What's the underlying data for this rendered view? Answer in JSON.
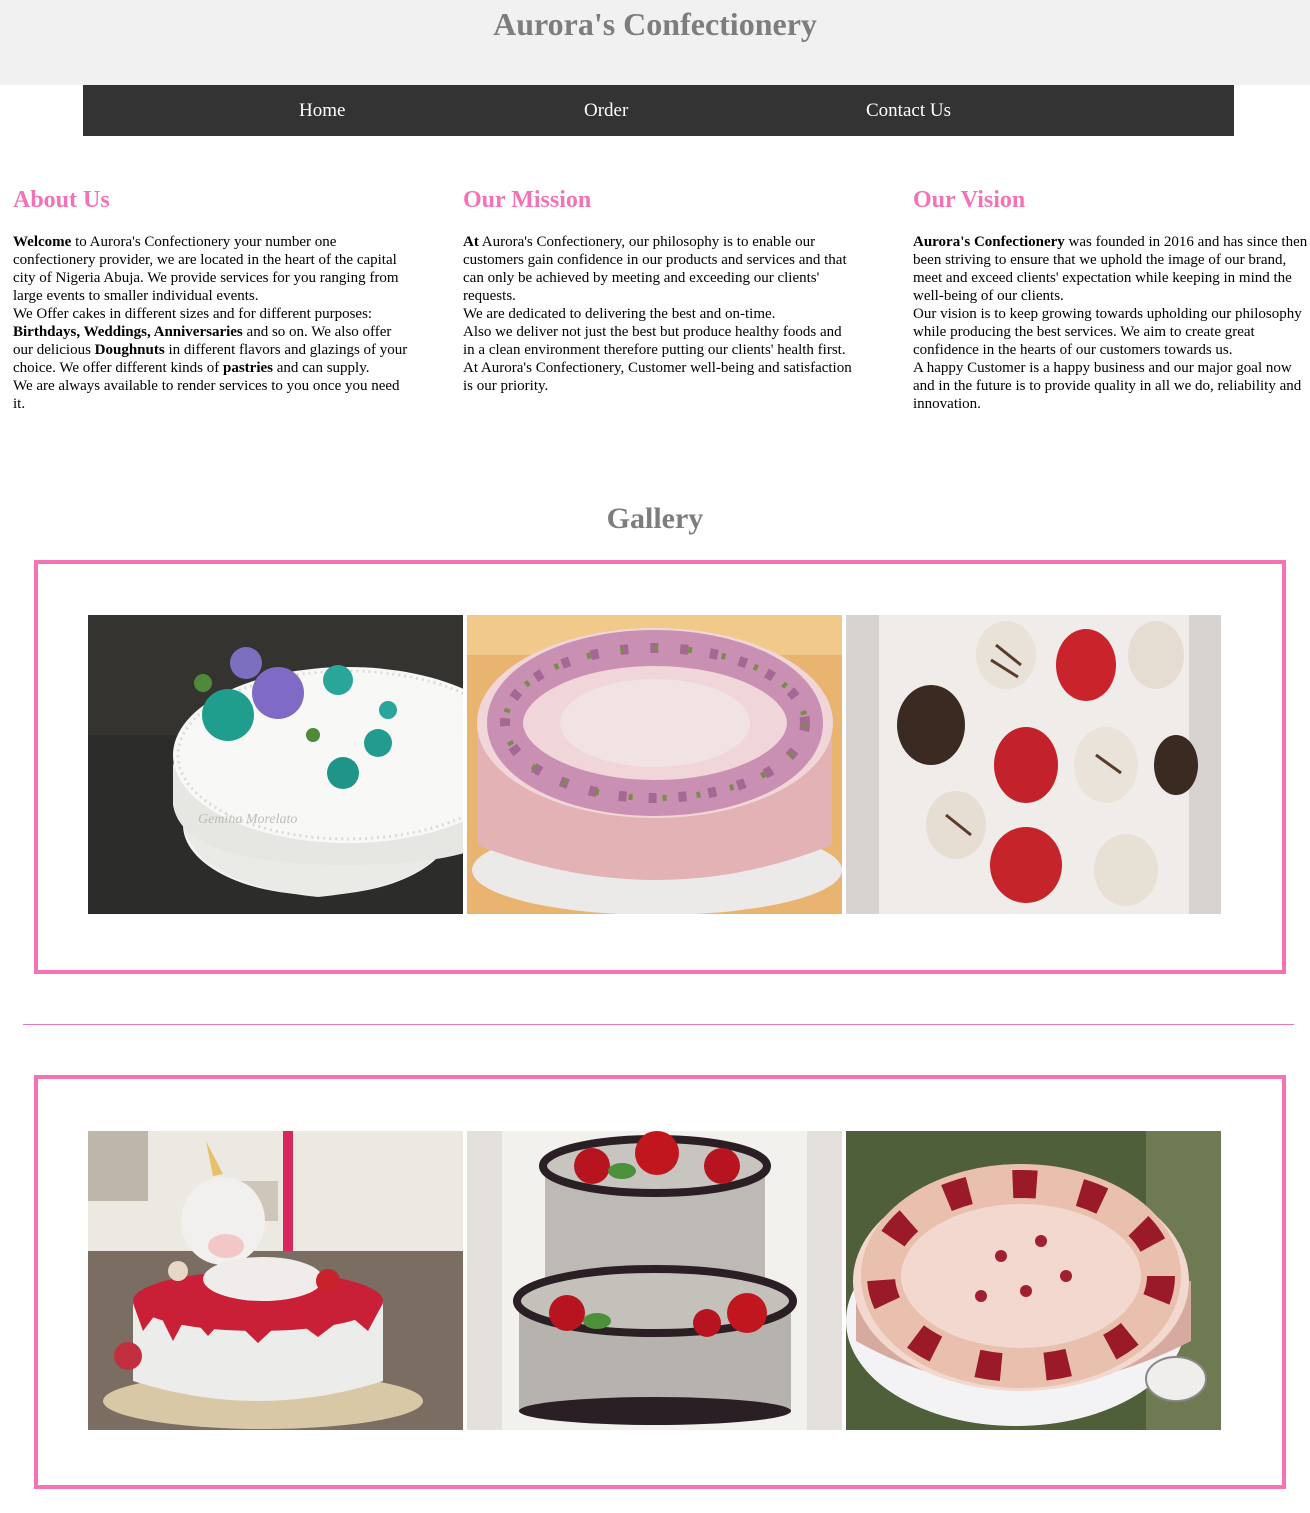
{
  "site": {
    "title": "Aurora's Confectionery"
  },
  "nav": [
    {
      "label": "Home"
    },
    {
      "label": "Order"
    },
    {
      "label": "Contact Us"
    }
  ],
  "about": {
    "heading": "About Us",
    "p1_bold": "Welcome",
    "p1_rest": " to Aurora's Confectionery your number one confectionery provider, we are located in the heart of the capital city of Nigeria Abuja. We provide services for you ranging from large events to smaller individual events.",
    "p2_a": "We Offer cakes in different sizes and for different purposes: ",
    "p2_bold": "Birthdays, Weddings, Anniversaries",
    "p2_b": " and so on. We also offer our delicious ",
    "p2_bold2": "Doughnuts",
    "p2_c": " in different flavors and glazings of your choice. We offer different kinds of ",
    "p2_bold3": "pastries",
    "p2_d": " and can supply.",
    "p3": "We are always available to render services to you once you need it."
  },
  "mission": {
    "heading": "Our Mission",
    "p1_bold": "At",
    "p1_rest": " Aurora's Confectionery, our philosophy is to enable our customers gain confidence in our products and services and that can only be achieved by meeting and exceeding our clients' requests.",
    "p2": "We are dedicated to delivering the best and on-time.",
    "p3": "Also we deliver not just the best but produce healthy foods and in a clean environment therefore putting our clients' health first.",
    "p4": "At Aurora's Confectionery, Customer well-being and satisfaction is our priority."
  },
  "vision": {
    "heading": "Our Vision",
    "p1_bold": "Aurora's Confectionery",
    "p1_rest": " was founded in 2016 and has since then been striving to ensure that we uphold the image of our brand, meet and exceed clients' expectation while keeping in mind the well-being of our clients.",
    "p2": "Our vision is to keep growing towards upholding our philosophy while producing the best services. We aim to create great confidence in the hearts of our customers towards us.",
    "p3": "A happy Customer is a happy business and our major goal now and in the future is to provide quality in all we do, reliability and innovation."
  },
  "gallery": {
    "heading": "Gallery",
    "watermark": "Gemina Morelato",
    "colors": {
      "accent": "#f472b6",
      "nav_bg": "#333333",
      "header_bg": "#f1f1f1",
      "title_gray": "#7d7d7d"
    }
  }
}
